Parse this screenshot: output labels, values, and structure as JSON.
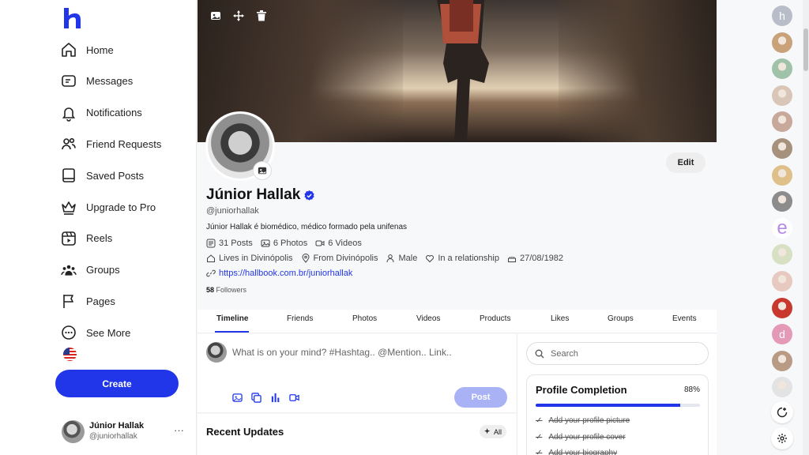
{
  "logo": {
    "letter": "h",
    "color": "#2136e8"
  },
  "nav": [
    {
      "label": "Home",
      "icon": "home-icon"
    },
    {
      "label": "Messages",
      "icon": "messages-icon"
    },
    {
      "label": "Notifications",
      "icon": "bell-icon"
    },
    {
      "label": "Friend Requests",
      "icon": "friends-icon"
    },
    {
      "label": "Saved Posts",
      "icon": "bookmark-icon"
    },
    {
      "label": "Upgrade to Pro",
      "icon": "crown-icon"
    },
    {
      "label": "Reels",
      "icon": "reels-icon"
    },
    {
      "label": "Groups",
      "icon": "groups-icon"
    },
    {
      "label": "Pages",
      "icon": "flag-icon"
    },
    {
      "label": "See More",
      "icon": "more-icon"
    }
  ],
  "create_label": "Create",
  "current_user": {
    "name": "Júnior Hallak",
    "handle": "@juniorhallak",
    "more": "···"
  },
  "profile": {
    "name": "Júnior Hallak",
    "handle": "@juniorhallak",
    "bio": "Júnior Hallak é biomédico, médico formado pela unifenas",
    "stats": {
      "posts": "31 Posts",
      "photos": "6 Photos",
      "videos": "6 Videos"
    },
    "lives_in": "Lives in Divinópolis",
    "from": "From Divinópolis",
    "gender": "Male",
    "relationship": "In a relationship",
    "birthday": "27/08/1982",
    "website": "https://hallbook.com.br/juniorhallak",
    "followers_count": "58",
    "followers_label": "Followers",
    "edit_label": "Edit"
  },
  "tabs": [
    "Timeline",
    "Friends",
    "Photos",
    "Videos",
    "Products",
    "Likes",
    "Groups",
    "Events"
  ],
  "active_tab": "Timeline",
  "composer": {
    "placeholder": "What is on your mind? #Hashtag.. @Mention.. Link..",
    "post_label": "Post"
  },
  "recent_updates": {
    "title": "Recent Updates",
    "filter_label": "All"
  },
  "search": {
    "placeholder": "Search"
  },
  "profile_completion": {
    "title": "Profile Completion",
    "percent_label": "88%",
    "percent": 88,
    "tasks": [
      "Add your profile picture",
      "Add your profile cover",
      "Add your biography"
    ]
  },
  "rail_avatars": [
    {
      "type": "letter",
      "letter": "h",
      "color": "#b9bdc9"
    },
    {
      "type": "photo",
      "color": "#c9a27a"
    },
    {
      "type": "photo",
      "color": "#9fc2a8"
    },
    {
      "type": "photo",
      "color": "#d9c6b8"
    },
    {
      "type": "photo",
      "color": "#c7a89a"
    },
    {
      "type": "photo",
      "color": "#a6927c"
    },
    {
      "type": "photo",
      "color": "#e0c08a"
    },
    {
      "type": "photo",
      "color": "#8c8c8c"
    },
    {
      "type": "letter",
      "letter": "e",
      "color": "#b58be8"
    },
    {
      "type": "photo",
      "color": "#d8e0c4"
    },
    {
      "type": "photo",
      "color": "#e7c9c0"
    },
    {
      "type": "photo",
      "color": "#c8382e"
    },
    {
      "type": "letter",
      "letter": "d",
      "color": "#e49ab6"
    },
    {
      "type": "photo",
      "color": "#b99a84"
    },
    {
      "type": "photo",
      "color": "#e3e3e3"
    }
  ]
}
